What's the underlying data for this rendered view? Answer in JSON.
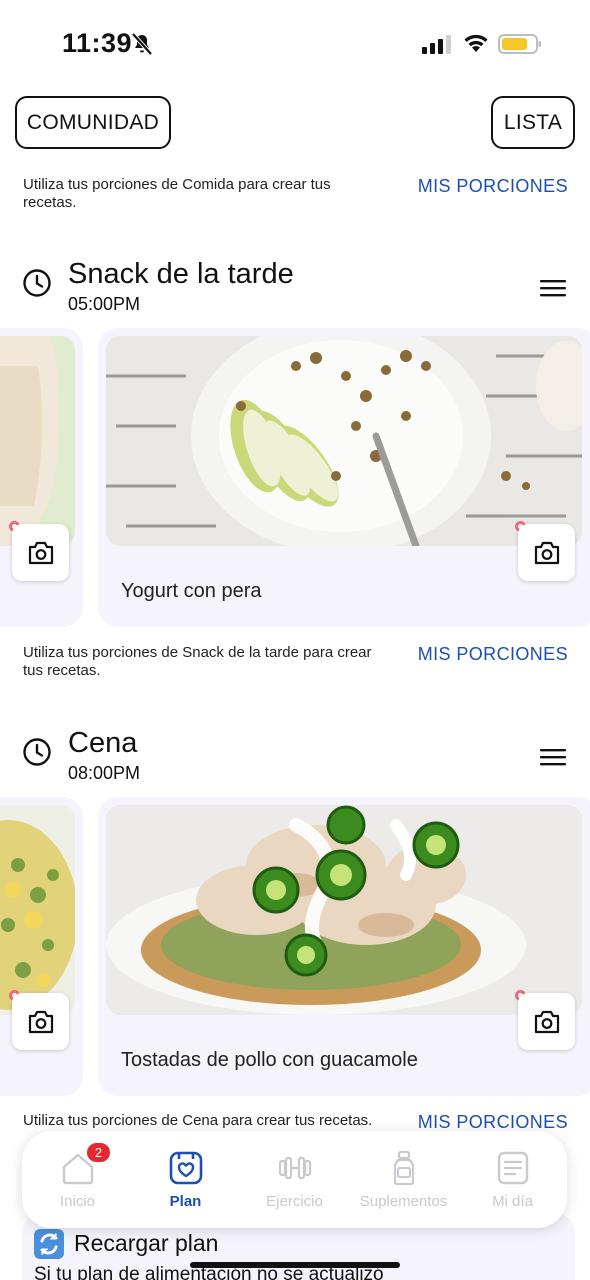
{
  "status_bar": {
    "time": "11:39"
  },
  "header": {
    "community_label": "COMUNIDAD",
    "list_label": "LISTA"
  },
  "hints": [
    {
      "text": "Utiliza tus porciones de Comida para crear tus recetas.",
      "link": "MIS PORCIONES"
    },
    {
      "text": "Utiliza tus porciones de Snack de la tarde para crear tus recetas.",
      "link": "MIS PORCIONES"
    },
    {
      "text": "Utiliza tus porciones de Cena para crear tus recetas.",
      "link": "MIS PORCIONES"
    }
  ],
  "sections": [
    {
      "title": "Snack de la tarde",
      "time": "05:00PM",
      "recipe": "Yogurt con pera"
    },
    {
      "title": "Cena",
      "time": "08:00PM",
      "recipe": "Tostadas de pollo con guacamole"
    }
  ],
  "nav": {
    "items": [
      {
        "label": "Inicio",
        "badge": "2"
      },
      {
        "label": "Plan"
      },
      {
        "label": "Ejercicio"
      },
      {
        "label": "Suplementos"
      },
      {
        "label": "Mi día"
      }
    ],
    "active": "Plan",
    "accent_color": "#1b4fb3"
  },
  "reload": {
    "title": "Recargar plan",
    "subtitle": "Si tu plan de alimentación no se actualizó"
  }
}
